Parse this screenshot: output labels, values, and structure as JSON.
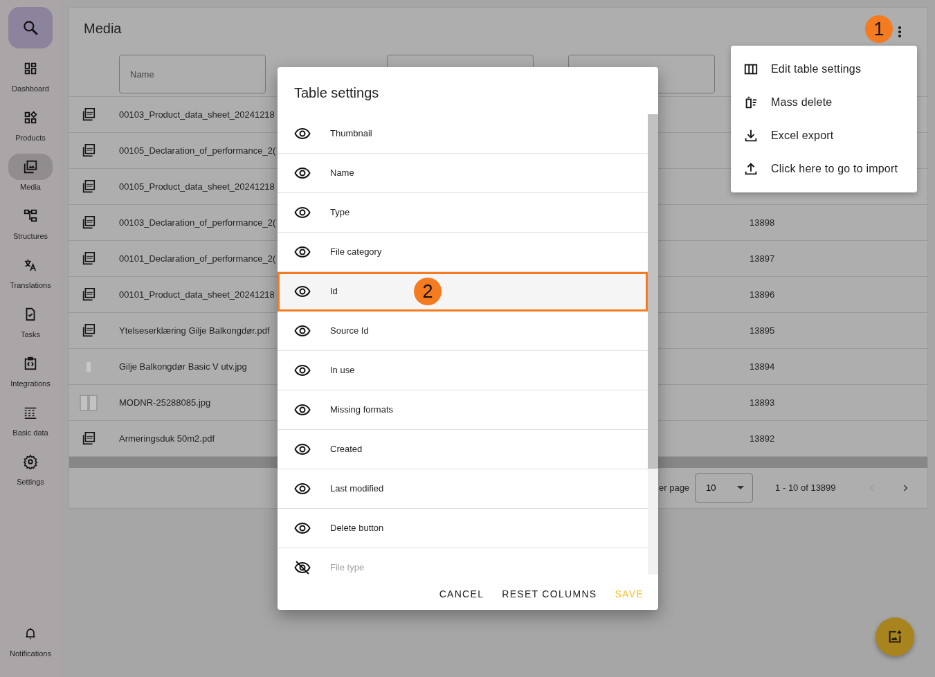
{
  "sidebar": {
    "items": [
      {
        "label": "Dashboard",
        "selected": false
      },
      {
        "label": "Products",
        "selected": false
      },
      {
        "label": "Media",
        "selected": true
      },
      {
        "label": "Structures",
        "selected": false
      },
      {
        "label": "Translations",
        "selected": false
      },
      {
        "label": "Tasks",
        "selected": false
      },
      {
        "label": "Integrations",
        "selected": false
      },
      {
        "label": "Basic data",
        "selected": false
      },
      {
        "label": "Settings",
        "selected": false
      }
    ],
    "bottom_item": {
      "label": "Notifications"
    }
  },
  "page": {
    "title": "Media",
    "filters": [
      {
        "kind": "text",
        "placeholder": "Name"
      },
      {
        "kind": "text"
      },
      {
        "kind": "text"
      }
    ],
    "rows": [
      {
        "kind": "pdf",
        "name": "00103_Product_data_sheet_20241218"
      },
      {
        "kind": "pdf",
        "name": "00105_Declaration_of_performance_2("
      },
      {
        "kind": "pdf",
        "name": "00105_Product_data_sheet_20241218"
      },
      {
        "kind": "pdf",
        "name": "00103_Declaration_of_performance_2(",
        "id": "13898"
      },
      {
        "kind": "pdf",
        "name": "00101_Declaration_of_performance_2(",
        "id": "13897"
      },
      {
        "kind": "pdf",
        "name": "00101_Product_data_sheet_20241218",
        "id": "13896"
      },
      {
        "kind": "pdf",
        "name": "Ytelseserklæring Gilje Balkongdør.pdf",
        "id": "13895"
      },
      {
        "kind": "photo",
        "name": "Gilje Balkongdør Basic V utv.jpg",
        "id": "13894"
      },
      {
        "kind": "tiles",
        "name": "MODNR-25288085.jpg",
        "id": "13893"
      },
      {
        "kind": "pdf",
        "name": "Armeringsduk 50m2.pdf",
        "id": "13892"
      }
    ],
    "pagination": {
      "rows_per_page_label": "er page",
      "rows_per_page": "10",
      "range": "1 - 10 of 13899",
      "prev_disabled": true,
      "next_disabled": false
    }
  },
  "menu": {
    "items": [
      {
        "label": "Edit table settings"
      },
      {
        "label": "Mass delete"
      },
      {
        "label": "Excel export"
      },
      {
        "label": "Click here to go to import"
      }
    ]
  },
  "dialog": {
    "title": "Table settings",
    "columns": [
      {
        "label": "Thumbnail",
        "visible": true,
        "highlighted": false
      },
      {
        "label": "Name",
        "visible": true,
        "highlighted": false
      },
      {
        "label": "Type",
        "visible": true,
        "highlighted": false
      },
      {
        "label": "File category",
        "visible": true,
        "highlighted": false
      },
      {
        "label": "Id",
        "visible": true,
        "highlighted": true
      },
      {
        "label": "Source Id",
        "visible": true,
        "highlighted": false
      },
      {
        "label": "In use",
        "visible": true,
        "highlighted": false
      },
      {
        "label": "Missing formats",
        "visible": true,
        "highlighted": false
      },
      {
        "label": "Created",
        "visible": true,
        "highlighted": false
      },
      {
        "label": "Last modified",
        "visible": true,
        "highlighted": false
      },
      {
        "label": "Delete button",
        "visible": true,
        "highlighted": false
      },
      {
        "label": "File type",
        "visible": false,
        "highlighted": false
      }
    ],
    "buttons": [
      {
        "label": "CANCEL",
        "kind": "plain"
      },
      {
        "label": "RESET COLUMNS",
        "kind": "plain"
      },
      {
        "label": "SAVE",
        "kind": "primary"
      }
    ],
    "scroll": {
      "level": 0.77
    }
  },
  "annotations": [
    {
      "label": "1"
    },
    {
      "label": "2"
    }
  ]
}
